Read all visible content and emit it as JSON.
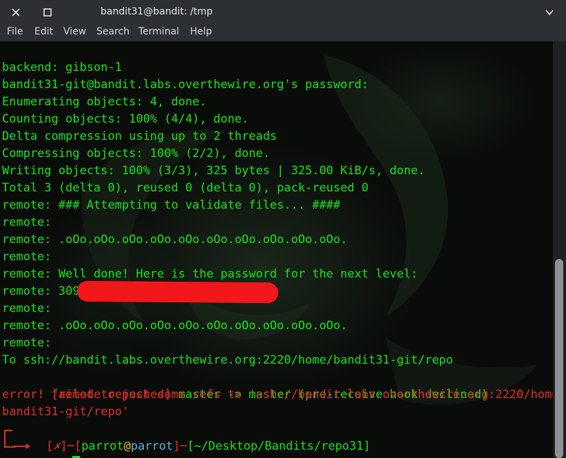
{
  "window": {
    "title": "bandit31@bandit: /tmp"
  },
  "menu": [
    "File",
    "Edit",
    "View",
    "Search",
    "Terminal",
    "Help"
  ],
  "terminal": {
    "lines": [
      "backend: gibson-1",
      "bandit31-git@bandit.labs.overthewire.org's password:",
      "Enumerating objects: 4, done.",
      "Counting objects: 100% (4/4), done.",
      "Delta compression using up to 2 threads",
      "Compressing objects: 100% (2/2), done.",
      "Writing objects: 100% (3/3), 325 bytes | 325.00 KiB/s, done.",
      "Total 3 (delta 0), reused 0 (delta 0), pack-reused 0",
      "remote: ### Attempting to validate files... ####",
      "remote:",
      "remote: .oOo.oOo.oOo.oOo.oOo.oOo.oOo.oOo.oOo.oOo.",
      "remote:",
      "remote: Well done! Here is the password for the next level:",
      "remote: 309",
      "remote:",
      "remote: .oOo.oOo.oOo.oOo.oOo.oOo.oOo.oOo.oOo.oOo.",
      "remote:",
      "To ssh://bandit.labs.overthewire.org:2220/home/bandit31-git/repo"
    ],
    "rejected": {
      "bang": " ! ",
      "tag": "[remote rejected]",
      "rest": " master -> master (pre-receive hook declined)"
    },
    "error_line1": "error: failed to push some refs to 'ssh://bandit.labs.overthewire.org:2220/home/",
    "error_line2": "bandit31-git/repo'",
    "prompt": {
      "status_open": "[",
      "status": "✗",
      "status_close": "]",
      "dash1": "─",
      "user_open": "[",
      "user": "parrot",
      "at": "@",
      "host": "parrot",
      "user_close": "]",
      "dash2": "─",
      "path": "[~/Desktop/Bandits/repo31]",
      "symbol": "$"
    }
  },
  "colors": {
    "text_green": "#19e519",
    "text_red": "#e0312a",
    "host_blue": "#5ab3e6",
    "redaction": "#f2171a"
  }
}
